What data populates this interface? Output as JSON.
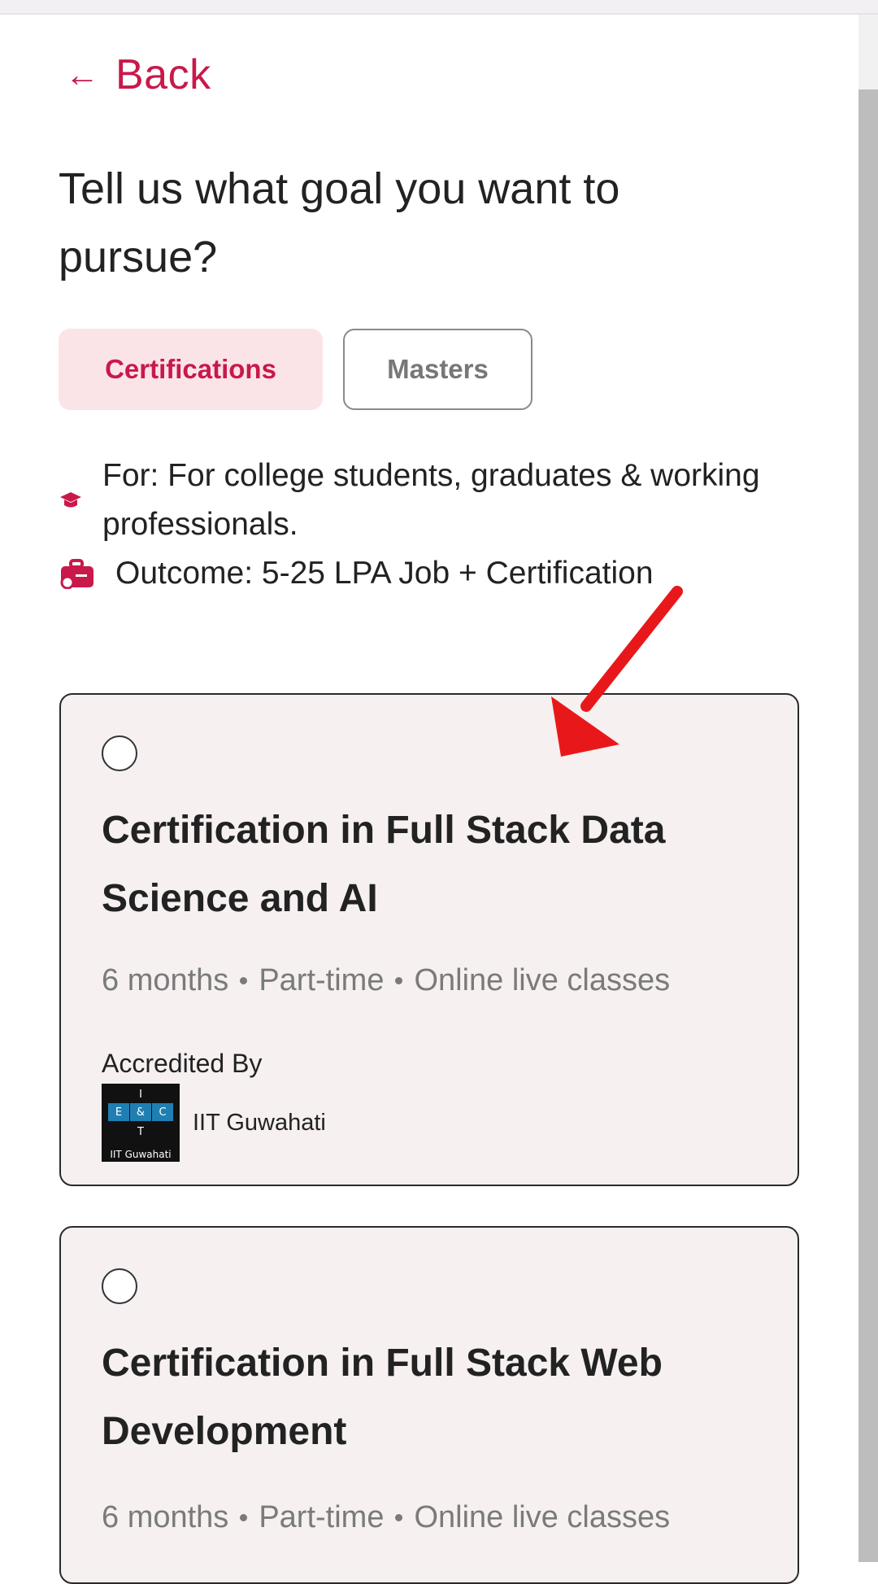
{
  "back": {
    "label": "Back",
    "icon": "arrow-left-icon"
  },
  "page": {
    "title": "Tell us what goal you want to pursue?"
  },
  "tabs": [
    {
      "label": "Certifications",
      "selected": true
    },
    {
      "label": "Masters",
      "selected": false
    }
  ],
  "info": {
    "for_text": "For: For college students, graduates & working professionals.",
    "outcome_text": "Outcome: 5-25 LPA Job + Certification",
    "for_icon": "graduation-cap-icon",
    "outcome_icon": "briefcase-money-icon"
  },
  "courses": [
    {
      "title": "Certification in Full Stack Data Science and AI",
      "duration": "6 months",
      "mode": "Part-time",
      "delivery": "Online live classes",
      "accredited_label": "Accredited By",
      "institute": "IIT Guwahati",
      "logo_caption": "IIT Guwahati",
      "logo_cells": [
        "I",
        "E",
        "&",
        "C",
        "T"
      ]
    },
    {
      "title": "Certification in Full Stack Web Development",
      "duration": "6 months",
      "mode": "Part-time",
      "delivery": "Online live classes"
    }
  ],
  "colors": {
    "accent": "#c8194a",
    "tab_selected_bg": "#fbe4e8",
    "card_bg": "#f6f0f0",
    "annotation_arrow": "#e8181a"
  }
}
